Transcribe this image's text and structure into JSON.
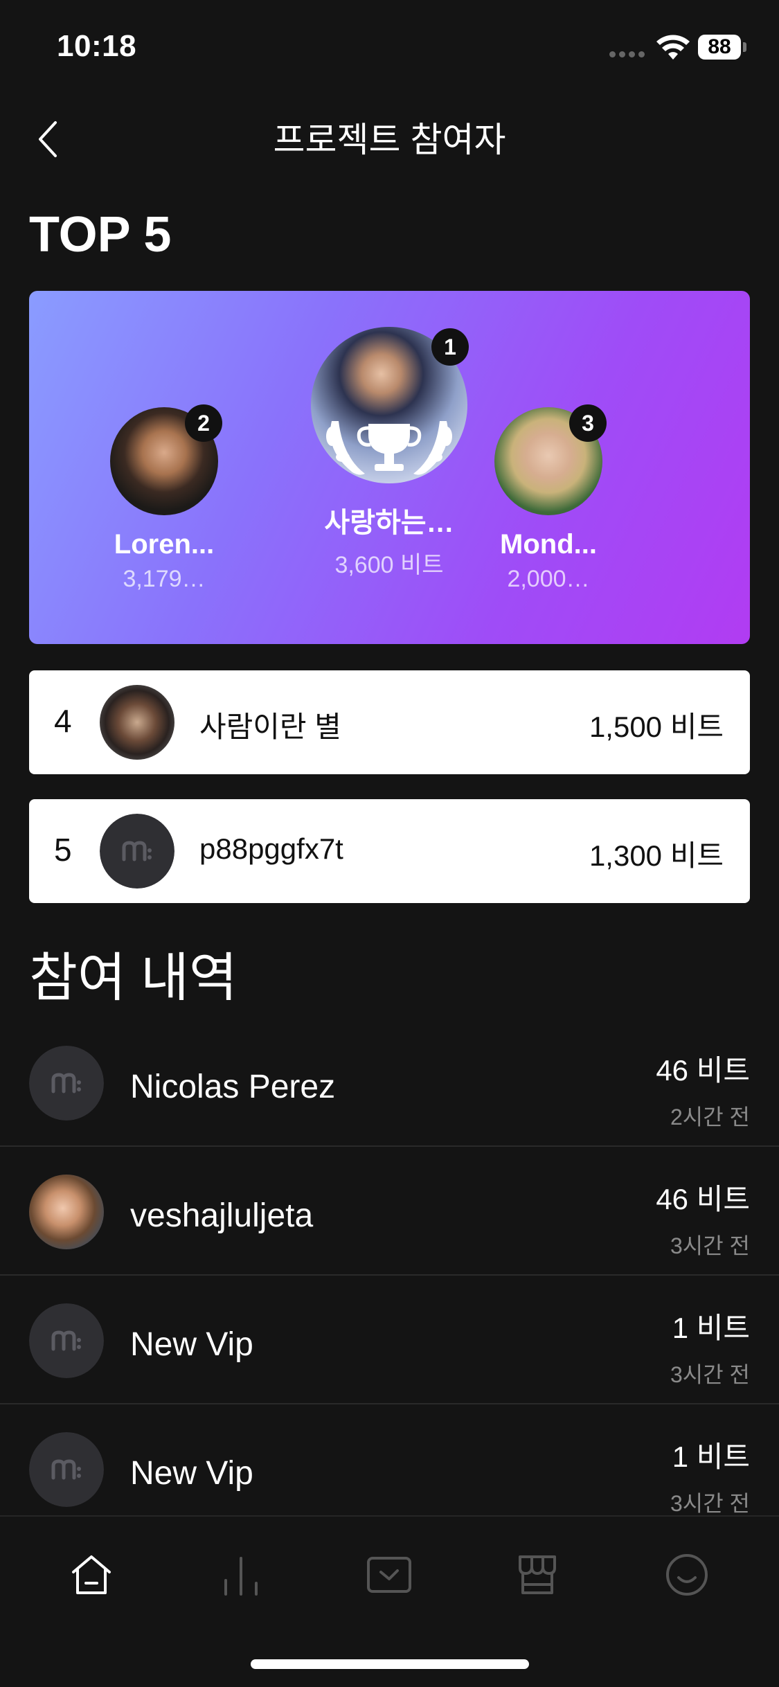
{
  "status_bar": {
    "time": "10:18",
    "battery": "88"
  },
  "header": {
    "title": "프로젝트 참여자"
  },
  "top5": {
    "title": "TOP 5",
    "podium": [
      {
        "rank": "1",
        "name": "사랑하는…",
        "bits": "3,600 비트"
      },
      {
        "rank": "2",
        "name": "Loren...",
        "bits": "3,179…"
      },
      {
        "rank": "3",
        "name": "Mond...",
        "bits": "2,000…"
      }
    ],
    "rows": [
      {
        "rank": "4",
        "name": "사람이란 별",
        "bits": "1,500 비트"
      },
      {
        "rank": "5",
        "name": "p88pggfx7t",
        "bits": "1,300 비트"
      }
    ]
  },
  "history": {
    "title": "참여 내역",
    "items": [
      {
        "name": "Nicolas Perez",
        "bits": "46 비트",
        "time": "2시간 전"
      },
      {
        "name": "veshajluljeta",
        "bits": "46 비트",
        "time": "3시간 전"
      },
      {
        "name": "New Vip",
        "bits": "1 비트",
        "time": "3시간 전"
      },
      {
        "name": "New Vip",
        "bits": "1 비트",
        "time": "3시간 전"
      }
    ]
  },
  "tabs": [
    {
      "icon": "home-icon",
      "active": true
    },
    {
      "icon": "chart-icon",
      "active": false
    },
    {
      "icon": "inbox-check-icon",
      "active": false
    },
    {
      "icon": "store-icon",
      "active": false
    },
    {
      "icon": "smiley-icon",
      "active": false
    }
  ],
  "colors": {
    "background": "#141414",
    "gradient_start": "#8a9cff",
    "gradient_end": "#b13cf2",
    "muted_text": "#8a8a8a"
  }
}
